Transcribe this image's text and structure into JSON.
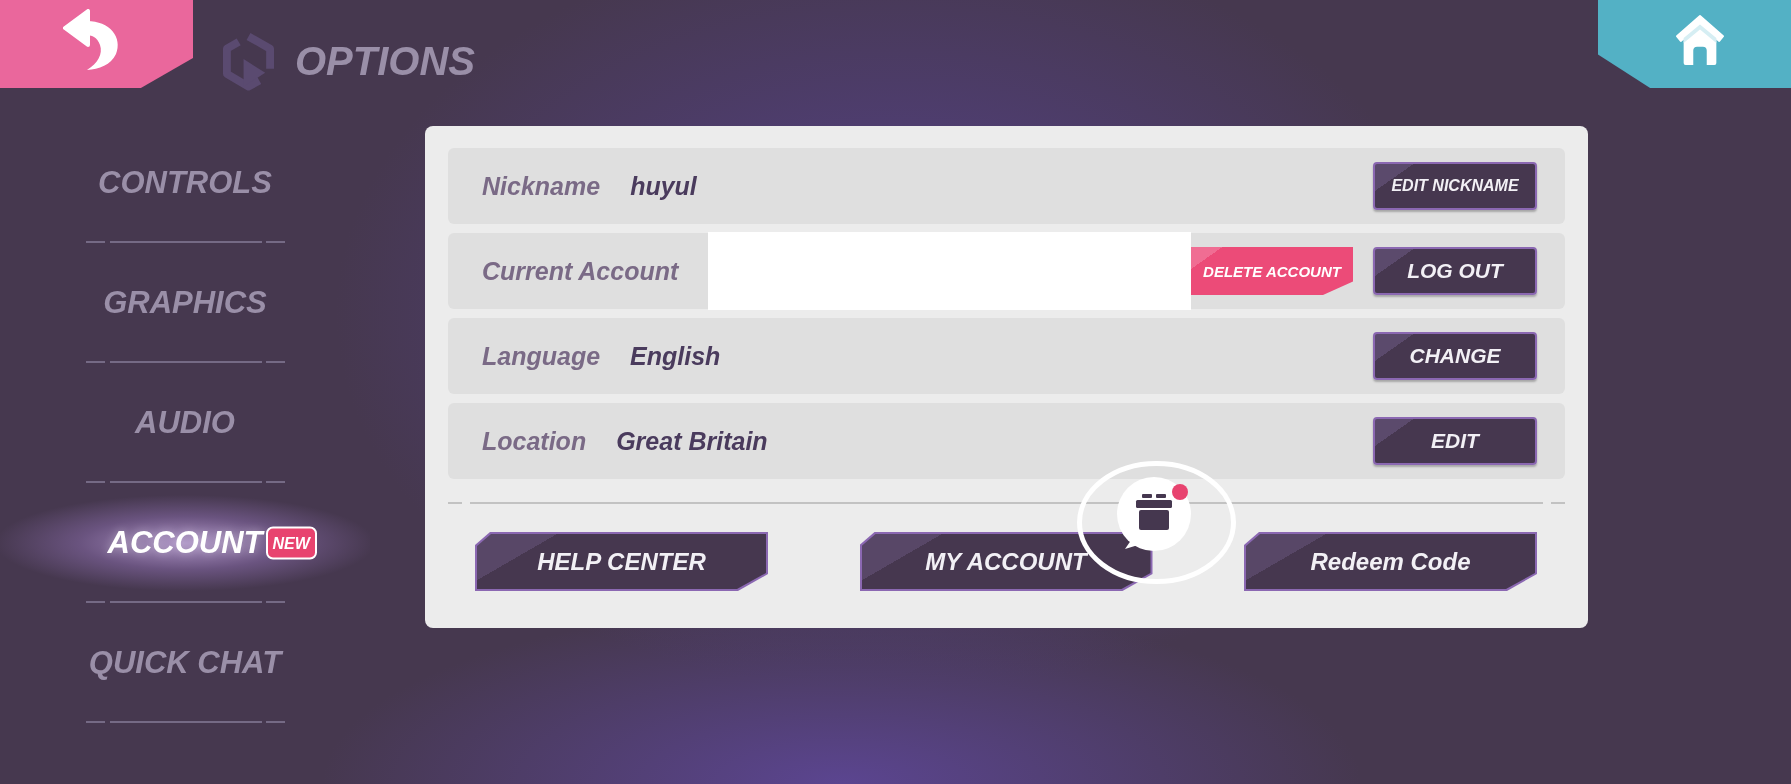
{
  "header": {
    "title": "OPTIONS"
  },
  "sidebar": {
    "items": [
      {
        "label": "CONTROLS",
        "selected": false
      },
      {
        "label": "GRAPHICS",
        "selected": false
      },
      {
        "label": "AUDIO",
        "selected": false
      },
      {
        "label": "ACCOUNT",
        "selected": true,
        "badge": "NEW"
      },
      {
        "label": "QUICK CHAT",
        "selected": false
      }
    ]
  },
  "account_panel": {
    "rows": [
      {
        "label": "Nickname",
        "value": "huyul",
        "redacted": false,
        "buttons": [
          {
            "label": "EDIT NICKNAME",
            "kind": "primary"
          }
        ]
      },
      {
        "label": "Current Account",
        "redacted": true,
        "buttons": [
          {
            "label": "DELETE ACCOUNT",
            "kind": "danger"
          },
          {
            "label": "LOG OUT",
            "kind": "primary"
          }
        ]
      },
      {
        "label": "Language",
        "value": "English",
        "redacted": false,
        "buttons": [
          {
            "label": "CHANGE",
            "kind": "primary"
          }
        ]
      },
      {
        "label": "Location",
        "value": "Great Britain",
        "redacted": false,
        "buttons": [
          {
            "label": "EDIT",
            "kind": "primary"
          }
        ]
      }
    ]
  },
  "footer_buttons": [
    {
      "label": "HELP CENTER",
      "notification": false
    },
    {
      "label": "MY ACCOUNT",
      "notification": true
    },
    {
      "label": "Redeem Code",
      "notification": false
    }
  ]
}
